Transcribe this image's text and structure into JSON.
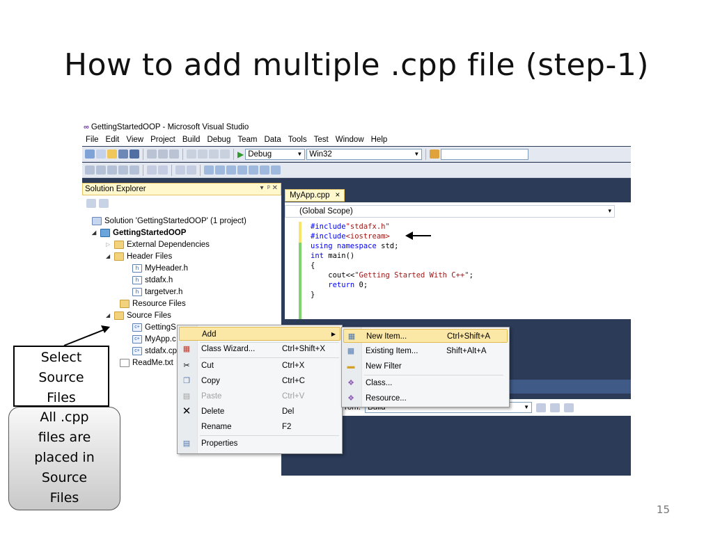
{
  "slide": {
    "title": "How to add multiple .cpp file (step-1)",
    "page_number": "15"
  },
  "window": {
    "title": "GettingStartedOOP - Microsoft Visual Studio"
  },
  "menu": [
    "File",
    "Edit",
    "View",
    "Project",
    "Build",
    "Debug",
    "Team",
    "Data",
    "Tools",
    "Test",
    "Window",
    "Help"
  ],
  "toolbar": {
    "config": "Debug",
    "platform": "Win32"
  },
  "solution_explorer": {
    "title": "Solution Explorer",
    "items": [
      {
        "label": "Solution 'GettingStartedOOP' (1 project)",
        "icon": "solution-icon"
      },
      {
        "label": "GettingStartedOOP",
        "icon": "project-icon"
      },
      {
        "label": "External Dependencies",
        "icon": "folder-icon"
      },
      {
        "label": "Header Files",
        "icon": "folder-open-icon"
      },
      {
        "label": "MyHeader.h",
        "icon": "header-file-icon"
      },
      {
        "label": "stdafx.h",
        "icon": "header-file-icon"
      },
      {
        "label": "targetver.h",
        "icon": "header-file-icon"
      },
      {
        "label": "Resource Files",
        "icon": "folder-icon"
      },
      {
        "label": "Source Files",
        "icon": "folder-open-icon"
      },
      {
        "label": "GettingS",
        "icon": "cpp-file-icon"
      },
      {
        "label": "MyApp.c",
        "icon": "cpp-file-icon"
      },
      {
        "label": "stdafx.cp",
        "icon": "cpp-file-icon"
      },
      {
        "label": "ReadMe.txt",
        "icon": "text-file-icon"
      }
    ]
  },
  "editor": {
    "tab_label": "MyApp.cpp",
    "tab_close": "×",
    "scope": "(Global Scope)",
    "code": {
      "l1a": "#include",
      "l1b": "\"stdafx.h\"",
      "l2a": "#include",
      "l2b": "<iostream>",
      "l3a": "using namespace",
      "l3b": " std;",
      "l4a": "int",
      "l4b": " main()",
      "l5": "{",
      "l6a": "    cout<<",
      "l6b": "\"Getting Started With C++\"",
      "l6c": ";",
      "l7a": "    return",
      "l7b": " 0;",
      "l8": "}"
    }
  },
  "output": {
    "from_label": "rom:",
    "from_value": "Build"
  },
  "context_menu": [
    {
      "label": "Add",
      "shortcut": "",
      "icon": "none"
    },
    {
      "label": "Class Wizard...",
      "shortcut": "Ctrl+Shift+X",
      "icon": "class-wizard-icon"
    },
    {
      "label": "Cut",
      "shortcut": "Ctrl+X",
      "icon": "scissors-icon"
    },
    {
      "label": "Copy",
      "shortcut": "Ctrl+C",
      "icon": "copy-icon"
    },
    {
      "label": "Paste",
      "shortcut": "Ctrl+V",
      "icon": "paste-icon"
    },
    {
      "label": "Delete",
      "shortcut": "Del",
      "icon": "delete-icon"
    },
    {
      "label": "Rename",
      "shortcut": "F2",
      "icon": "none"
    },
    {
      "label": "Properties",
      "shortcut": "",
      "icon": "properties-icon"
    }
  ],
  "add_submenu": [
    {
      "label": "New Item...",
      "shortcut": "Ctrl+Shift+A",
      "icon": "new-item-icon"
    },
    {
      "label": "Existing Item...",
      "shortcut": "Shift+Alt+A",
      "icon": "existing-item-icon"
    },
    {
      "label": "New Filter",
      "shortcut": "",
      "icon": "folder-icon"
    },
    {
      "label": "Class...",
      "shortcut": "",
      "icon": "class-icon"
    },
    {
      "label": "Resource...",
      "shortcut": "",
      "icon": "resource-icon"
    }
  ],
  "callouts": {
    "select": [
      "Select",
      "Source",
      "Files"
    ],
    "cpp": [
      "All .cpp",
      "files are",
      "placed in",
      "Source",
      "Files"
    ]
  },
  "colors": {
    "ide_background": "#2b3b58",
    "highlight": "#fbe7a6",
    "keyword": "#0000ff",
    "string": "#a31515"
  }
}
